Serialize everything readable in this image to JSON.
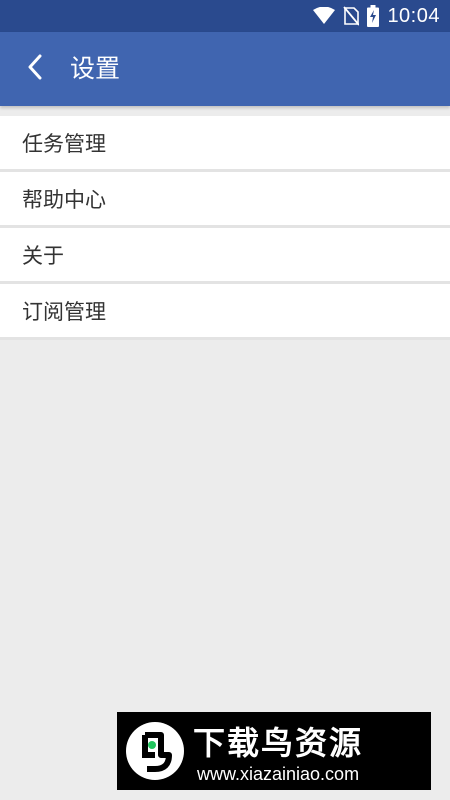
{
  "status_bar": {
    "time": "10:04",
    "icons": [
      "wifi-icon",
      "no-sim-icon",
      "battery-charging-icon"
    ]
  },
  "app_bar": {
    "back_icon": "chevron-left-icon",
    "title": "设置"
  },
  "settings": {
    "items": [
      {
        "label": "任务管理"
      },
      {
        "label": "帮助中心"
      },
      {
        "label": "关于"
      },
      {
        "label": "订阅管理"
      }
    ]
  },
  "watermark": {
    "title": "下载鸟资源",
    "url": "www.xiazainiao.com"
  },
  "colors": {
    "status_bar": "#2a4a8e",
    "app_bar": "#4065b0",
    "background": "#ececec",
    "item_background": "#ffffff",
    "text": "#333333"
  }
}
